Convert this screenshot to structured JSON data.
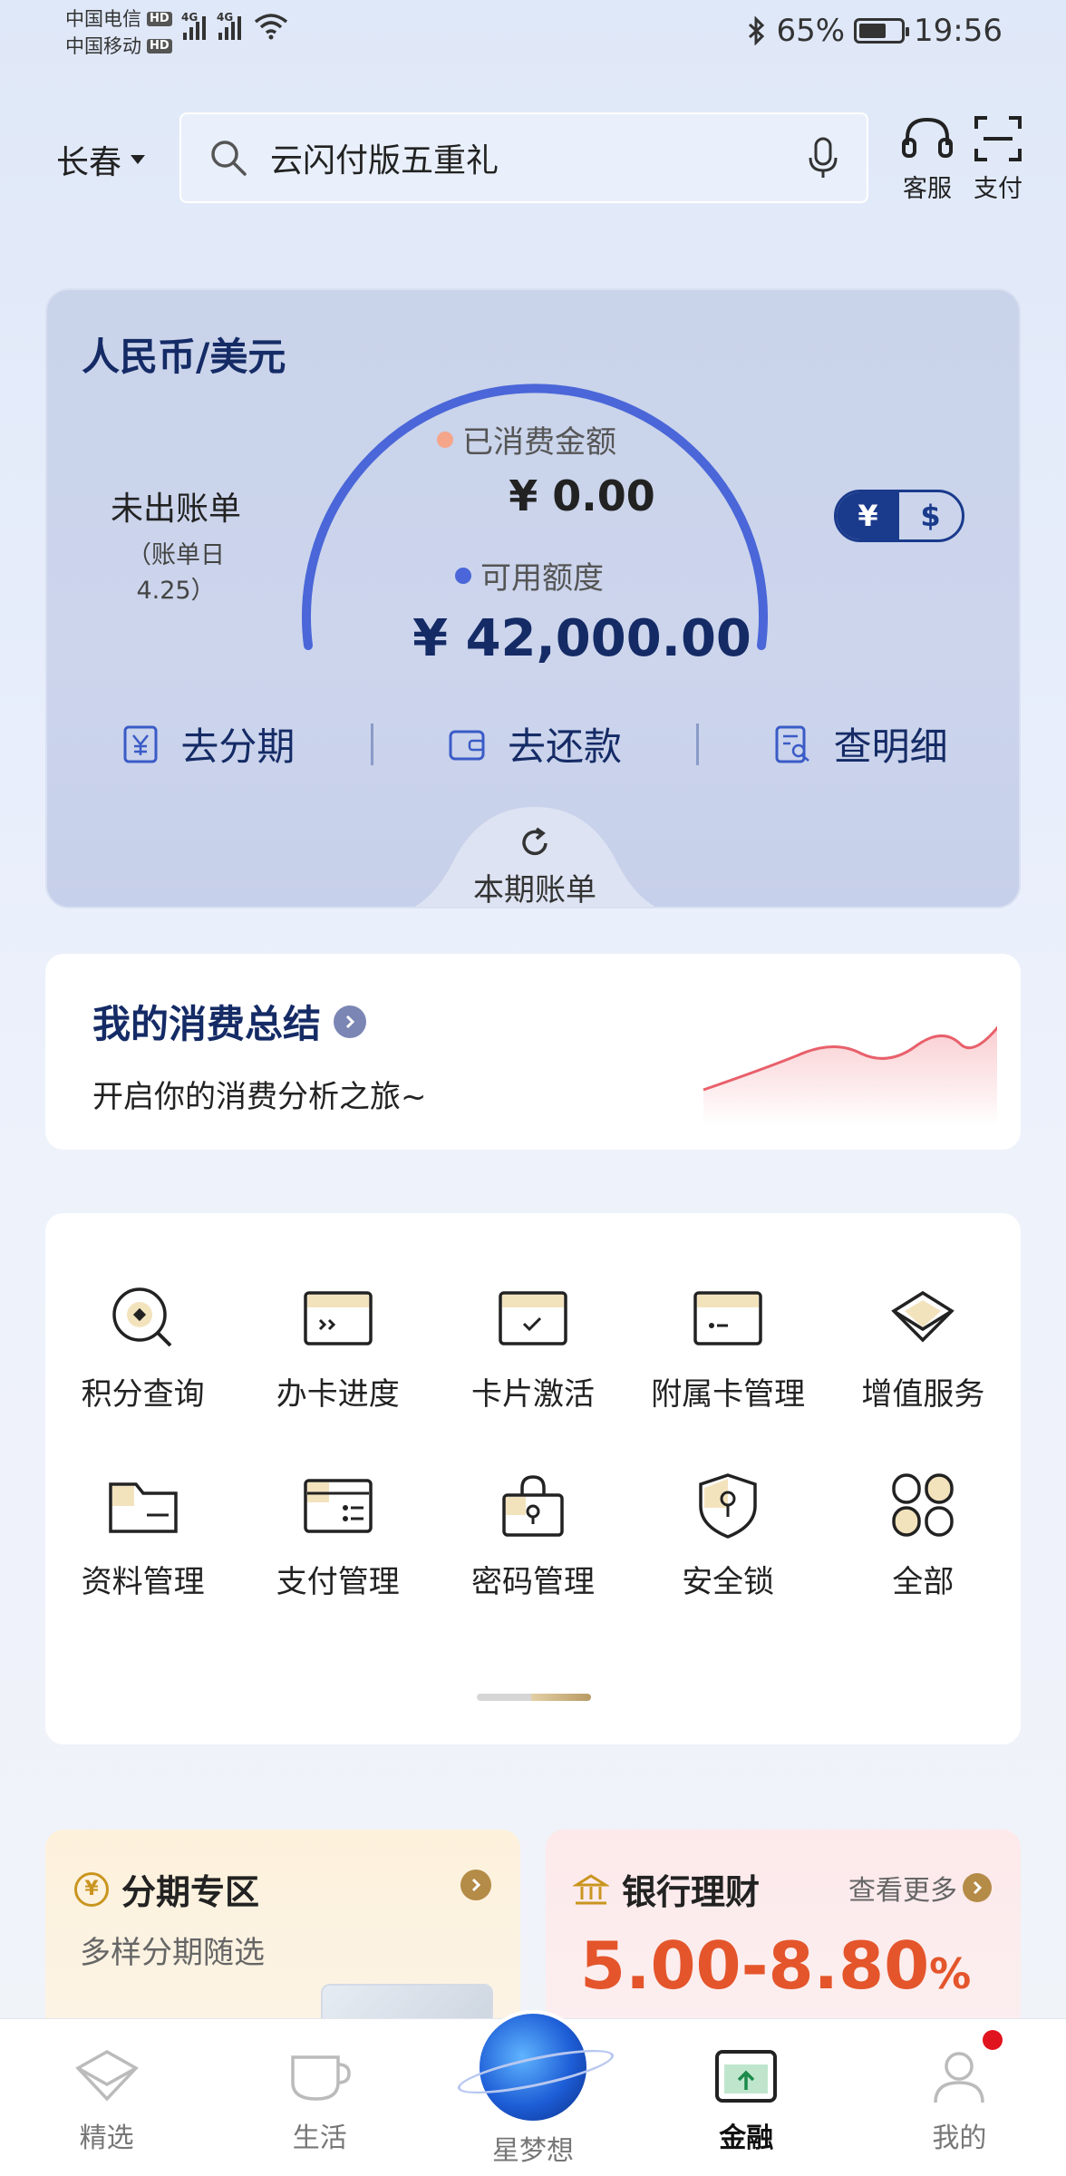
{
  "status_bar": {
    "carrier1": "中国电信",
    "carrier2": "中国移动",
    "hd": "HD",
    "net1": "4G",
    "net2": "4G",
    "battery": "65%",
    "battery_level": 0.65,
    "time": "19:56"
  },
  "header": {
    "city": "长春",
    "search_text": "云闪付版五重礼",
    "service_label": "客服",
    "pay_label": "支付"
  },
  "bill_card": {
    "currency_title": "人民币/美元",
    "unbilled_title": "未出账单",
    "bill_day": "（账单日4.25）",
    "spent_label": "已消费金额",
    "spent_value": "¥ 0.00",
    "available_label": "可用额度",
    "available_value": "¥ 42,000.00",
    "toggle_cny": "¥",
    "toggle_usd": "$",
    "actions": [
      {
        "label": "去分期"
      },
      {
        "label": "去还款"
      },
      {
        "label": "查明细"
      }
    ],
    "period_label": "本期账单",
    "colors": {
      "arc": "#4a66d8",
      "spent_dot": "#f5a58a",
      "available_dot": "#4a66d8"
    }
  },
  "summary": {
    "title": "我的消费总结",
    "subtitle": "开启你的消费分析之旅~"
  },
  "services": [
    {
      "label": "积分查询",
      "icon": "points-icon"
    },
    {
      "label": "办卡进度",
      "icon": "card-progress-icon"
    },
    {
      "label": "卡片激活",
      "icon": "card-activate-icon"
    },
    {
      "label": "附属卡管理",
      "icon": "sub-card-icon"
    },
    {
      "label": "增值服务",
      "icon": "value-added-icon"
    },
    {
      "label": "资料管理",
      "icon": "profile-icon"
    },
    {
      "label": "支付管理",
      "icon": "wallet-icon"
    },
    {
      "label": "密码管理",
      "icon": "lock-icon"
    },
    {
      "label": "安全锁",
      "icon": "shield-icon"
    },
    {
      "label": "全部",
      "icon": "grid-icon"
    }
  ],
  "promos": {
    "installment": {
      "title": "分期专区",
      "coin": "¥",
      "subtitle": "多样分期随选"
    },
    "wealth": {
      "title": "银行理财",
      "more": "查看更多",
      "rate": "5.00-8.80",
      "pct": "%"
    }
  },
  "tabbar": [
    {
      "label": "精选"
    },
    {
      "label": "生活"
    },
    {
      "label": "星梦想"
    },
    {
      "label": "金融"
    },
    {
      "label": "我的"
    }
  ]
}
